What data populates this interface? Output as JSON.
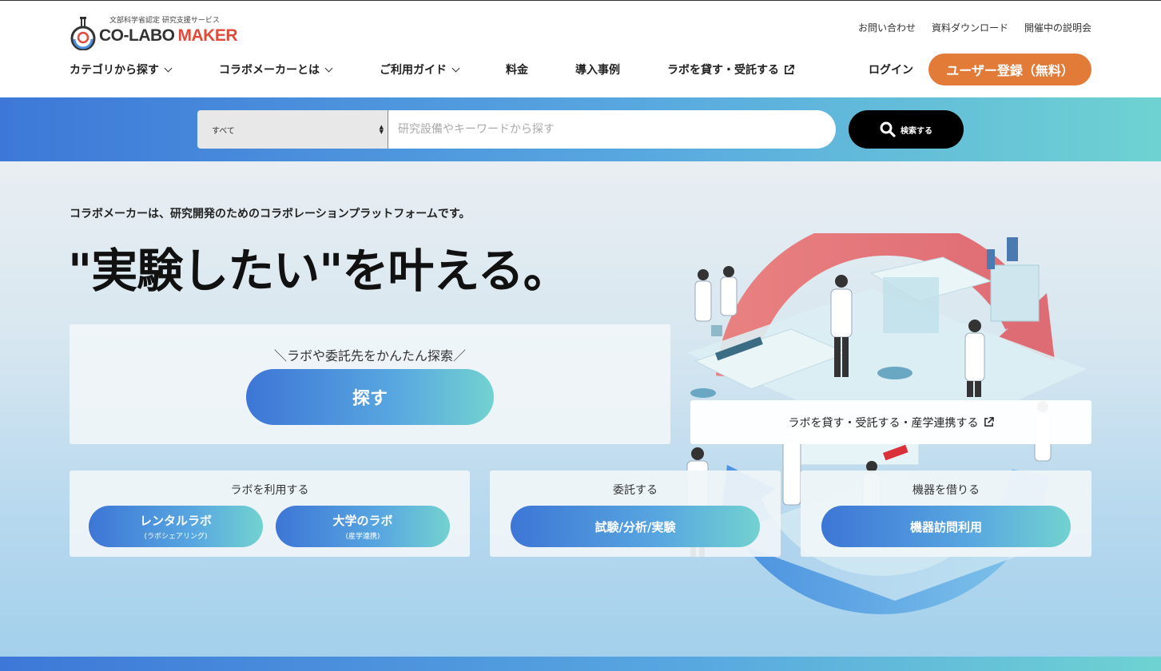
{
  "header": {
    "logo_sub": "文部科学省認定 研究支援サービス",
    "logo_main": "CO-LABO",
    "logo_accent": "MAKER",
    "utility_links": [
      "お問い合わせ",
      "資料ダウンロード",
      "開催中の説明会"
    ],
    "nav": [
      {
        "label": "カテゴリから探す",
        "icon": "chevron-down-icon"
      },
      {
        "label": "コラボメーカーとは",
        "icon": "chevron-down-icon"
      },
      {
        "label": "ご利用ガイド",
        "icon": "chevron-down-icon"
      },
      {
        "label": "料金"
      },
      {
        "label": "導入事例"
      },
      {
        "label": "ラボを貸す・受託する",
        "icon": "external-link-icon"
      }
    ],
    "login": "ログイン",
    "register": "ユーザー登録（無料）"
  },
  "search": {
    "category_selected": "すべて",
    "placeholder": "研究設備やキーワードから探す",
    "button": "検索する"
  },
  "hero": {
    "tagline": "コラボメーカーは、研究開発のためのコラボレーションプラットフォームです。",
    "headline": "\"実験したい\"を叶える。",
    "search_card": {
      "label": "＼ラボや委託先をかんたん探索／",
      "button": "探す"
    },
    "lend_card": {
      "label": "ラボを貸す・受託する・産学連携する",
      "icon": "external-link-icon"
    },
    "use_lab": {
      "title": "ラボを利用する",
      "buttons": [
        {
          "main": "レンタルラボ",
          "sub": "(ラボシェアリング)"
        },
        {
          "main": "大学のラボ",
          "sub": "(産学連携)"
        }
      ]
    },
    "outsource": {
      "title": "委託する",
      "button": "試験/分析/実験"
    },
    "rent_equipment": {
      "title": "機器を借りる",
      "button": "機器訪問利用"
    }
  },
  "colors": {
    "accent_orange": "#e27a38",
    "gradient_start": "#3d78d8",
    "gradient_end": "#6ed2d2",
    "logo_red": "#e04a3a"
  }
}
